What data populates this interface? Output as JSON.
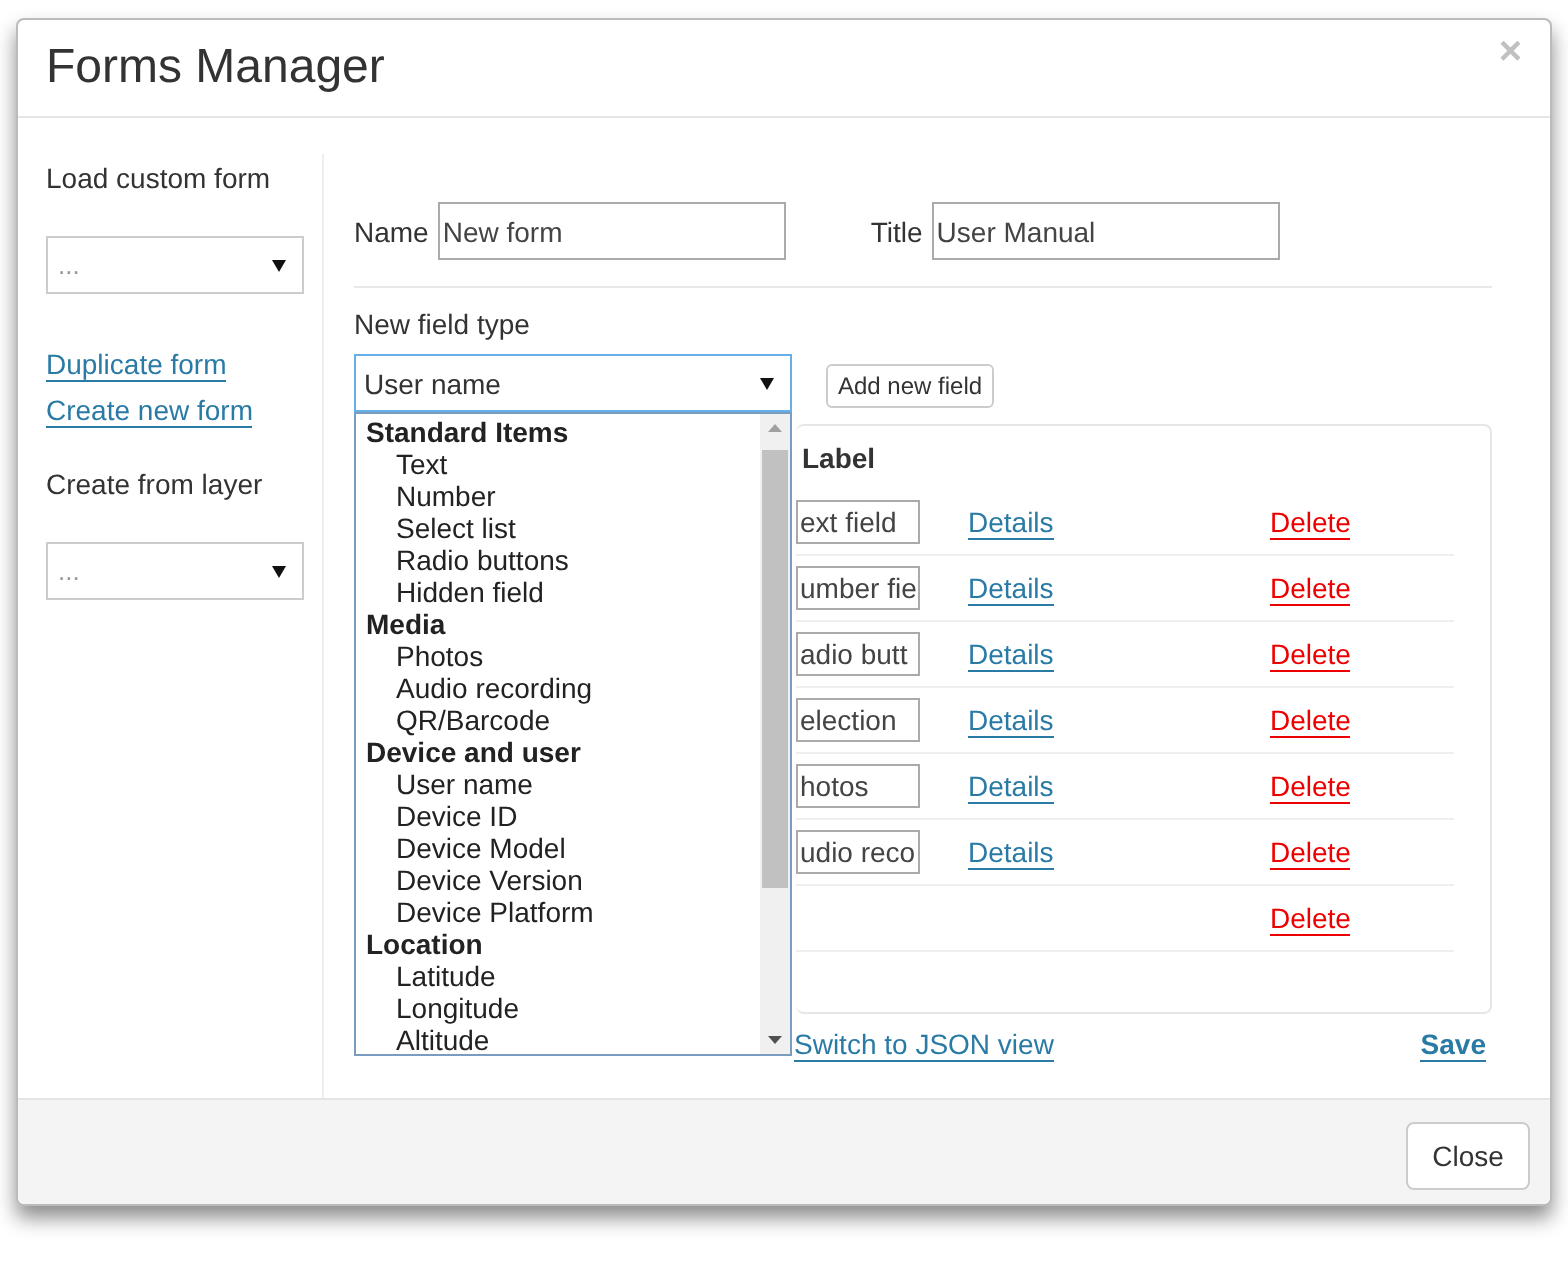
{
  "window": {
    "title": "Forms Manager",
    "close_glyph": "×"
  },
  "sidebar": {
    "load_label": "Load custom form",
    "load_select": "...",
    "links": [
      "Duplicate form",
      "Create new form"
    ],
    "layer_label": "Create from layer",
    "layer_select": "..."
  },
  "form": {
    "name_label": "Name",
    "name_value": "New form",
    "title_label": "Title",
    "title_value": "User Manual",
    "field_type_label": "New field type",
    "field_type_value": "User name",
    "add_button": "Add new field"
  },
  "dropdown": {
    "groups": [
      {
        "label": "Standard Items",
        "options": [
          "Text",
          "Number",
          "Select list",
          "Radio buttons",
          "Hidden field"
        ]
      },
      {
        "label": "Media",
        "options": [
          "Photos",
          "Audio recording",
          "QR/Barcode"
        ]
      },
      {
        "label": "Device and user",
        "options": [
          "User name",
          "Device ID",
          "Device Model",
          "Device Version",
          "Device Platform"
        ]
      },
      {
        "label": "Location",
        "options": [
          "Latitude",
          "Longitude",
          "Altitude"
        ]
      }
    ]
  },
  "table": {
    "column_header": "Label",
    "rows": [
      {
        "label": "ext field",
        "details": "Details",
        "delete": "Delete"
      },
      {
        "label": "umber fie",
        "details": "Details",
        "delete": "Delete"
      },
      {
        "label": "adio butt",
        "details": "Details",
        "delete": "Delete"
      },
      {
        "label": "election",
        "details": "Details",
        "delete": "Delete"
      },
      {
        "label": "hotos",
        "details": "Details",
        "delete": "Delete"
      },
      {
        "label": "udio reco",
        "details": "Details",
        "delete": "Delete"
      },
      {
        "delete": "Delete"
      }
    ]
  },
  "json_link": "Switch to JSON view",
  "save_link": "Save",
  "close_button": "Close"
}
